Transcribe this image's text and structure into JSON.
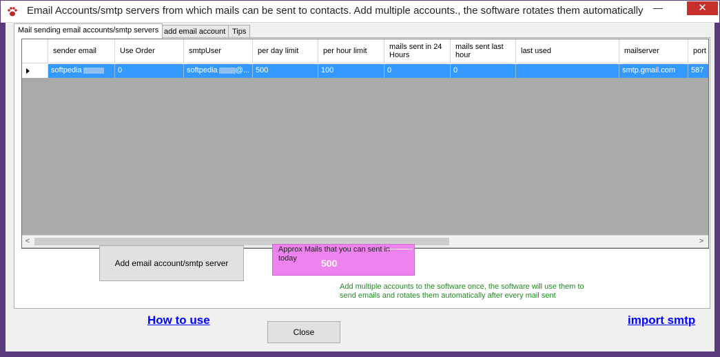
{
  "window": {
    "title": "Email Accounts/smtp servers from which mails can be sent to contacts. Add multiple accounts., the software rotates them automatically",
    "minimize_glyph": "—",
    "close_glyph": "✕",
    "app_icon": "paw-icon"
  },
  "tabs": [
    {
      "label": "Mail sending email accounts/smtp servers",
      "active": true
    },
    {
      "label": "add email account",
      "active": false
    },
    {
      "label": "Tips",
      "active": false
    }
  ],
  "grid": {
    "columns": [
      {
        "label": "sender email"
      },
      {
        "label": "Use Order"
      },
      {
        "label": "smtpUser"
      },
      {
        "label": "per day limit"
      },
      {
        "label": "per hour limit"
      },
      {
        "label": "mails sent in 24 Hours"
      },
      {
        "label": "mails sent last hour"
      },
      {
        "label": "last used"
      },
      {
        "label": "mailserver"
      },
      {
        "label": "port"
      }
    ],
    "rows": [
      {
        "sender_email": "softpedia",
        "use_order": "0",
        "smtp_user_prefix": "softpedia",
        "smtp_user_suffix": "@...",
        "per_day_limit": "500",
        "per_hour_limit": "100",
        "sent_24h": "0",
        "sent_last_hour": "0",
        "last_used": "",
        "mailserver": "smtp.gmail.com",
        "port": "587"
      }
    ],
    "selection_color": "#3399ff",
    "background_color": "#aaaaaa"
  },
  "actions": {
    "add_account_label": "Add email account/smtp server",
    "close_label": "Close",
    "how_to_use_label": "How to use",
    "import_smtp_label": "import smtp"
  },
  "approx": {
    "label": "Approx Mails that you can sent in today",
    "value": "500",
    "color": "#ee82ee"
  },
  "info_text": "Add multiple accounts to the software once, the software will use them to send emails and rotates them automatically after every mail sent"
}
